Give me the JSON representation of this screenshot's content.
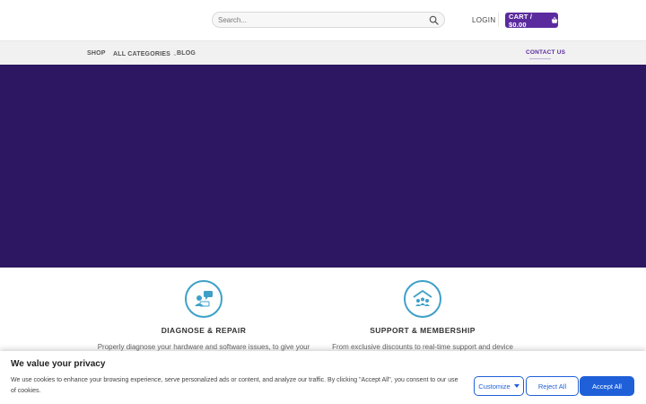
{
  "header": {
    "search_placeholder": "Search...",
    "login_label": "LOGIN",
    "cart_label": "CART / $0.00"
  },
  "nav": {
    "items": [
      {
        "label": "SHOP"
      },
      {
        "label": "ALL CATEGORIES",
        "chevron": "chevron-down-icon"
      },
      {
        "label": "BLOG"
      }
    ],
    "contact_label": "CONTACT US"
  },
  "colors": {
    "brand_purple": "#5b2a9e",
    "hero_bg": "#2e1762",
    "icon_teal": "#3ea0c8",
    "cookie_blue": "#1f60d8"
  },
  "features": [
    {
      "icon": "chat-support-icon",
      "title": "DIAGNOSE & REPAIR",
      "description": "Properly diagnose your hardware and software issues, to give your"
    },
    {
      "icon": "house-members-icon",
      "title": "SUPPORT & MEMBERSHIP",
      "description": "From exclusive discounts to real-time support and device"
    }
  ],
  "cookie": {
    "heading": "We value your privacy",
    "text": "We use cookies to enhance your browsing experience, serve personalized ads or content, and analyze our traffic. By clicking \"Accept All\", you consent to our use of cookies.",
    "customize_label": "Customize",
    "reject_label": "Reject All",
    "accept_label": "Accept All"
  }
}
